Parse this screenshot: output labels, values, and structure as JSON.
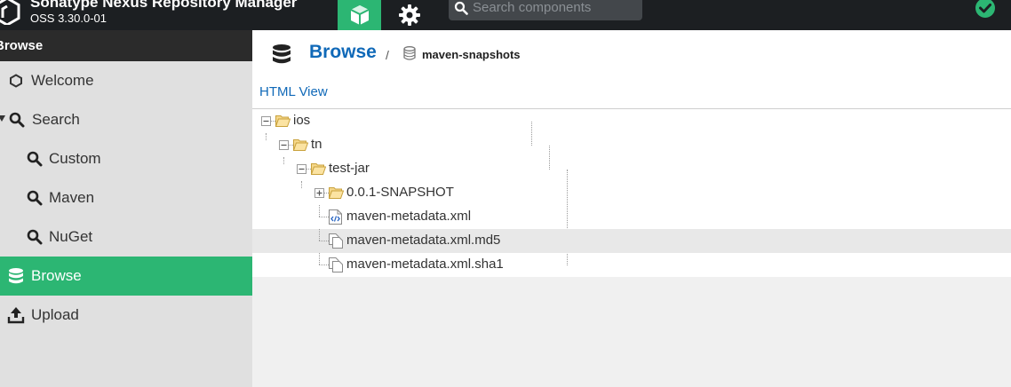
{
  "header": {
    "app_title": "Sonatype Nexus Repository Manager",
    "app_version": "OSS 3.30.0-01",
    "search_placeholder": "Search components",
    "brand_color": "#2cb673",
    "icons": {
      "logo": "nexus-hexagon-icon",
      "browse": "cube-icon",
      "admin": "gear-icon",
      "search": "search-icon",
      "status": "check-circle-icon"
    }
  },
  "sidebar": {
    "header": "Browse",
    "items": [
      {
        "label": "Welcome",
        "icon": "hexagon-icon"
      },
      {
        "label": "Search",
        "icon": "search-icon",
        "expanded": true
      },
      {
        "label": "Custom",
        "icon": "search-icon"
      },
      {
        "label": "Maven",
        "icon": "search-icon"
      },
      {
        "label": "NuGet",
        "icon": "search-icon"
      },
      {
        "label": "Browse",
        "icon": "database-icon",
        "active": true
      },
      {
        "label": "Upload",
        "icon": "upload-icon"
      }
    ]
  },
  "main": {
    "breadcrumb": {
      "title": "Browse",
      "separator": "/",
      "repository": "maven-snapshots"
    },
    "html_view": "HTML View",
    "tree": [
      {
        "label": "ios",
        "type": "folder",
        "expanded": true
      },
      {
        "label": "tn",
        "type": "folder",
        "expanded": true
      },
      {
        "label": "test-jar",
        "type": "folder",
        "expanded": true
      },
      {
        "label": "0.0.1-SNAPSHOT",
        "type": "folder",
        "expanded": false
      },
      {
        "label": "maven-metadata.xml",
        "type": "xml-file"
      },
      {
        "label": "maven-metadata.xml.md5",
        "type": "file",
        "selected": true
      },
      {
        "label": "maven-metadata.xml.sha1",
        "type": "file"
      }
    ]
  }
}
